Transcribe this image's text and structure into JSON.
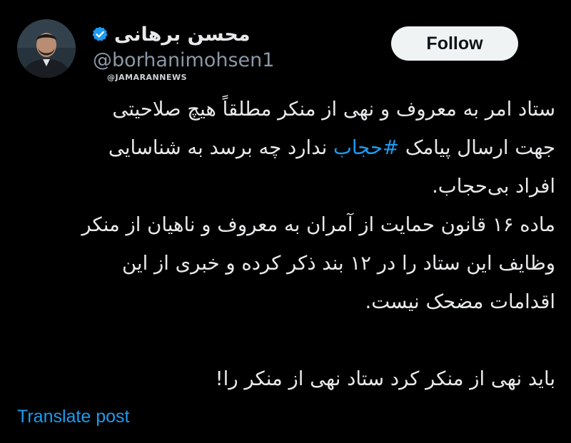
{
  "author": {
    "display_name": "محسن برهانی",
    "handle": "@borhanimohsen1",
    "verified_icon": "verified-badge-icon",
    "verified_color": "#1d9bf0"
  },
  "watermark": "@JAMARANNEWS",
  "follow_button": {
    "label": "Follow"
  },
  "tweet": {
    "line1": "ستاد امر به معروف و نهی از منکر مطلقاً هیچ صلاحیتی",
    "line2_before": "جهت ارسال پیامک ",
    "line2_hashtag": "#حجاب",
    "line2_after": " ندارد چه برسد به شناسایی",
    "line3": "افراد بی‌حجاب.",
    "line4": "ماده ۱۶ قانون حمایت از آمران به معروف و ناهیان از منکر",
    "line5": "وظایف این ستاد را در ۱۲ بند ذکر کرده و خبری از این",
    "line6": "اقدامات مضحک نیست.",
    "line7": "باید نهی از منکر کرد ستاد نهی از منکر را!"
  },
  "translate": {
    "label": "Translate post"
  },
  "colors": {
    "background": "#000000",
    "text": "#e7e9ea",
    "secondary_text": "#8b98a5",
    "link": "#1d9bf0",
    "follow_bg": "#eff3f4"
  }
}
